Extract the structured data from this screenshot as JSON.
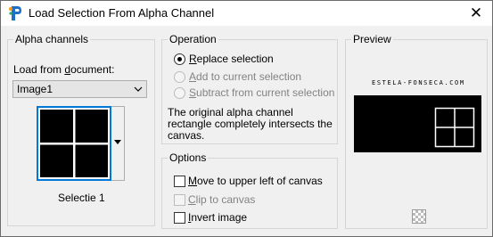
{
  "window": {
    "title": "Load Selection From Alpha Channel",
    "close_label": "✕",
    "app_icon": "paintshop-pro-icon"
  },
  "alpha_channels": {
    "group_title": "Alpha channels",
    "load_from_label_pre": "Load from ",
    "load_from_label_mnemonic": "d",
    "load_from_label_post": "ocument:",
    "document_value": "Image1",
    "channel_name": "Selectie 1"
  },
  "operation": {
    "group_title": "Operation",
    "options": [
      {
        "mnemonic": "R",
        "rest": "eplace selection",
        "selected": true,
        "enabled": true
      },
      {
        "mnemonic": "A",
        "rest": "dd to current selection",
        "selected": false,
        "enabled": false
      },
      {
        "mnemonic": "S",
        "rest": "ubtract from current selection",
        "selected": false,
        "enabled": false
      }
    ],
    "description_line1": "The original alpha channel",
    "description_line2": "rectangle completely intersects the",
    "description_line3": "canvas."
  },
  "options": {
    "group_title": "Options",
    "items": [
      {
        "mnemonic": "M",
        "rest": "ove to upper left of canvas",
        "checked": false,
        "enabled": true
      },
      {
        "mnemonic": "C",
        "rest": "lip to canvas",
        "checked": false,
        "enabled": false
      },
      {
        "mnemonic": "I",
        "rest": "nvert image",
        "checked": false,
        "enabled": true
      }
    ]
  },
  "preview": {
    "group_title": "Preview",
    "watermark": "ESTELA-FONSECA.COM",
    "background_icon": "transparency-checker-icon"
  },
  "colors": {
    "accent": "#0078d7",
    "selection_fill": "#000000",
    "selection_lines": "#ffffff"
  }
}
